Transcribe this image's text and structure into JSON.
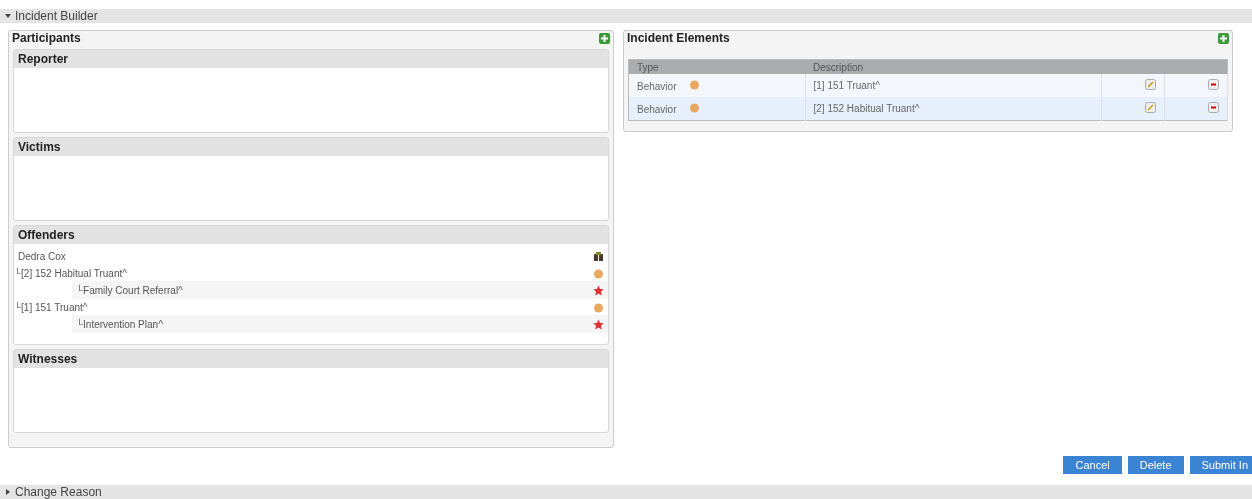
{
  "builder": {
    "title": "Incident Builder",
    "expanded": true
  },
  "participants": {
    "title": "Participants",
    "sections": [
      {
        "title": "Reporter"
      },
      {
        "title": "Victims"
      },
      {
        "title": "Offenders",
        "items": [
          {
            "label": "Dedra Cox",
            "kind": "person",
            "children": [
              {
                "label": "└[2] 152 Habitual Truant^",
                "kind": "behavior",
                "children": [
                  {
                    "label": "└Family Court Referral^",
                    "kind": "resolution"
                  }
                ]
              },
              {
                "label": "└[1] 151 Truant^",
                "kind": "behavior",
                "children": [
                  {
                    "label": "└Intervention Plan^",
                    "kind": "resolution"
                  }
                ]
              }
            ]
          }
        ]
      },
      {
        "title": "Witnesses"
      }
    ]
  },
  "elements": {
    "title": "Incident Elements",
    "columns": [
      "Type",
      "Description"
    ],
    "rows": [
      {
        "type": "Behavior",
        "description": "[1] 151 Truant^"
      },
      {
        "type": "Behavior",
        "description": "[2] 152 Habitual Truant^"
      }
    ]
  },
  "buttons": [
    "Cancel",
    "Delete",
    "Submit In"
  ],
  "change_reason": {
    "title": "Change Reason",
    "expanded": false
  }
}
